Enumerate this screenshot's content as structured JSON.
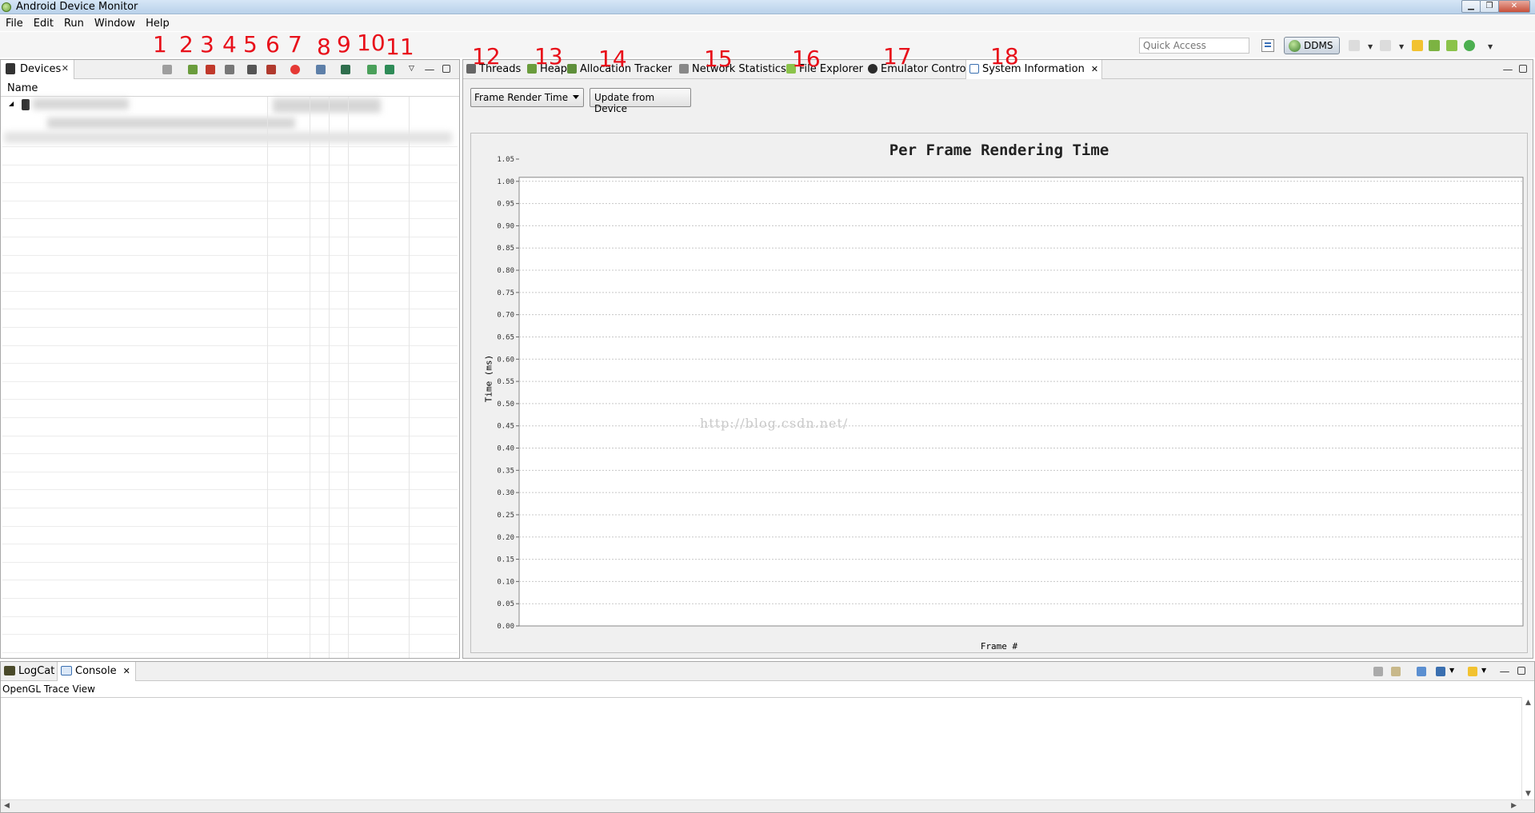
{
  "window": {
    "title": "Android Device Monitor"
  },
  "menu": [
    "File",
    "Edit",
    "Run",
    "Window",
    "Help"
  ],
  "toolbar": {
    "quick_access_placeholder": "Quick Access",
    "perspective": "DDMS"
  },
  "annotations": [
    "1",
    "2",
    "3",
    "4",
    "5",
    "6",
    "7",
    "8",
    "9",
    "10",
    "11",
    "12",
    "13",
    "14",
    "15",
    "16",
    "17",
    "18"
  ],
  "devices_panel": {
    "tab": "Devices",
    "column_name": "Name"
  },
  "main_tabs": [
    "Threads",
    "Heap",
    "Allocation Tracker",
    "Network Statistics",
    "File Explorer",
    "Emulator Control",
    "System Information"
  ],
  "system_info": {
    "selected_option": "Frame Render Time",
    "update_button": "Update from Device"
  },
  "chart_data": {
    "type": "bar",
    "title": "Per Frame Rendering Time",
    "xlabel": "Frame #",
    "ylabel": "Time (ms)",
    "ylim": [
      0.0,
      1.05
    ],
    "yticks": [
      "0.00",
      "0.05",
      "0.10",
      "0.15",
      "0.20",
      "0.25",
      "0.30",
      "0.35",
      "0.40",
      "0.45",
      "0.50",
      "0.55",
      "0.60",
      "0.65",
      "0.70",
      "0.75",
      "0.80",
      "0.85",
      "0.90",
      "0.95",
      "1.00",
      "1.05"
    ],
    "categories": [],
    "values": [],
    "grid": true
  },
  "watermark": "http://blog.csdn.net/",
  "bottom_panel": {
    "tabs": [
      "LogCat",
      "Console"
    ],
    "console_title": "OpenGL Trace View"
  }
}
